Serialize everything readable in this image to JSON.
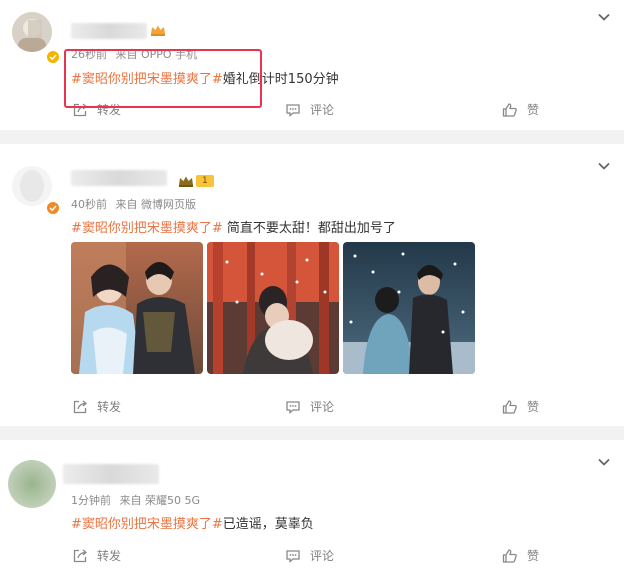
{
  "posts": [
    {
      "time": "26秒前",
      "source": "来自 OPPO 手机",
      "topic": "#窦昭你别把宋墨摸爽了#",
      "text": "婚礼倒计时150分钟",
      "repost": "转发",
      "comment": "评论",
      "like": "赞"
    },
    {
      "time": "40秒前",
      "source": "来自 微博网页版",
      "fan_level": "1",
      "topic": "#窦昭你别把宋墨摸爽了#",
      "text": " 简直不要太甜！都甜出加号了",
      "repost": "转发",
      "comment": "评论",
      "like": "赞"
    },
    {
      "time": "1分钟前",
      "source": "来自 荣耀50 5G",
      "topic": "#窦昭你别把宋墨摸爽了#",
      "text": "已造谣，莫辜负",
      "repost": "转发",
      "comment": "评论",
      "like": "赞"
    }
  ],
  "icons": {
    "expand": "chevron-down-icon",
    "repost": "share-icon",
    "comment": "comment-icon",
    "like": "thumbs-up-icon",
    "verified": "verified-badge-icon",
    "vip": "crown-icon"
  },
  "colors": {
    "topic": "#eb7340",
    "highlight": "#e8344f",
    "meta": "#8a8a8a",
    "action": "#808080"
  }
}
